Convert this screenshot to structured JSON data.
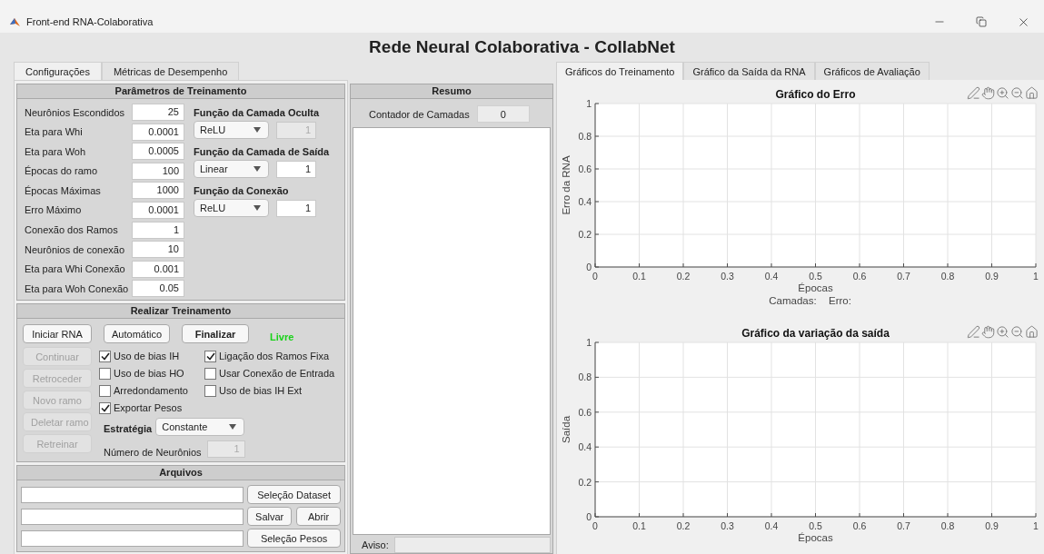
{
  "window": {
    "title": "Front-end RNA-Colaborativa"
  },
  "app_title": "Rede Neural Colaborativa - CollabNet",
  "left_tabs": [
    {
      "label": "Configurações",
      "selected": true
    },
    {
      "label": "Métricas de Desempenho",
      "selected": false
    }
  ],
  "training_params": {
    "title": "Parâmetros de Treinamento",
    "fields": [
      {
        "label": "Neurônios Escondidos",
        "value": "25"
      },
      {
        "label": "Eta para Whi",
        "value": "0.0001"
      },
      {
        "label": "Eta para Woh",
        "value": "0.0005"
      },
      {
        "label": "Épocas do ramo",
        "value": "100"
      },
      {
        "label": "Épocas Máximas",
        "value": "1000"
      },
      {
        "label": "Erro Máximo",
        "value": "0.0001"
      },
      {
        "label": "Conexão dos Ramos",
        "value": "1"
      },
      {
        "label": "Neurônios de conexão",
        "value": "10"
      },
      {
        "label": "Eta para Whi Conexão",
        "value": "0.001"
      },
      {
        "label": "Eta para Woh Conexão",
        "value": "0.05"
      }
    ],
    "functions": [
      {
        "title": "Função da Camada Oculta",
        "dropdown": "ReLU",
        "value": "1",
        "disabled": true
      },
      {
        "title": "Função da Camada de Saída",
        "dropdown": "Linear",
        "value": "1",
        "disabled": false
      },
      {
        "title": "Função da Conexão",
        "dropdown": "ReLU",
        "value": "1",
        "disabled": false
      }
    ]
  },
  "training": {
    "title": "Realizar Treinamento",
    "top_buttons": [
      {
        "label": "Iniciar RNA",
        "bold": false,
        "disabled": false
      },
      {
        "label": "Automático",
        "bold": false,
        "disabled": false
      },
      {
        "label": "Finalizar",
        "bold": true,
        "disabled": false
      }
    ],
    "status": "Livre",
    "side_buttons": [
      {
        "label": "Continuar",
        "disabled": true
      },
      {
        "label": "Retroceder",
        "disabled": true
      },
      {
        "label": "Novo ramo",
        "disabled": true
      },
      {
        "label": "Deletar ramo",
        "disabled": true
      },
      {
        "label": "Retreinar",
        "disabled": true
      }
    ],
    "checkboxes_left": [
      {
        "label": "Uso de bias IH",
        "checked": true
      },
      {
        "label": "Uso de bias HO",
        "checked": false
      },
      {
        "label": "Arredondamento",
        "checked": false
      },
      {
        "label": "Exportar Pesos",
        "checked": true
      }
    ],
    "checkboxes_right": [
      {
        "label": "Ligação dos Ramos Fixa",
        "checked": true
      },
      {
        "label": "Usar Conexão de Entrada",
        "checked": false
      },
      {
        "label": "Uso de bias IH Ext",
        "checked": false
      }
    ],
    "strategy": {
      "label": "Estratégia",
      "value": "Constante"
    },
    "neuron_count": {
      "label": "Número de Neurônios",
      "value": "1",
      "disabled": true
    }
  },
  "files": {
    "title": "Arquivos",
    "rows": [
      {
        "buttons": [
          "Seleção Dataset"
        ]
      },
      {
        "buttons": [
          "Salvar",
          "Abrir"
        ]
      },
      {
        "buttons": [
          "Seleção Pesos"
        ]
      }
    ]
  },
  "summary": {
    "title": "Resumo",
    "counter_label": "Contador de Camadas",
    "counter_value": "0",
    "notice_label": "Aviso:"
  },
  "right_tabs": [
    {
      "label": "Gráficos do Treinamento",
      "selected": true
    },
    {
      "label": "Gráfico da Saída da RNA",
      "selected": false
    },
    {
      "label": "Gráficos de Avaliação",
      "selected": false
    }
  ],
  "charts": [
    {
      "footer": [
        "Camadas:",
        "Erro:"
      ],
      "chart_data": {
        "type": "line",
        "title": "Gráfico do Erro",
        "grid": true,
        "xlabel": "Épocas",
        "ylabel": "Erro da RNA",
        "xlim": [
          0,
          1
        ],
        "ylim": [
          0,
          1
        ],
        "xticks": [
          0,
          0.1,
          0.2,
          0.3,
          0.4,
          0.5,
          0.6,
          0.7,
          0.8,
          0.9,
          1
        ],
        "yticks": [
          0,
          0.2,
          0.4,
          0.6,
          0.8,
          1
        ]
      }
    },
    {
      "chart_data": {
        "type": "line",
        "title": "Gráfico da variação da saída",
        "grid": true,
        "xlabel": "Épocas",
        "ylabel": "Saída",
        "xlim": [
          0,
          1
        ],
        "ylim": [
          0,
          1
        ],
        "xticks": [
          0,
          0.1,
          0.2,
          0.3,
          0.4,
          0.5,
          0.6,
          0.7,
          0.8,
          0.9,
          1
        ],
        "yticks": [
          0,
          0.2,
          0.4,
          0.6,
          0.8,
          1
        ]
      }
    }
  ]
}
